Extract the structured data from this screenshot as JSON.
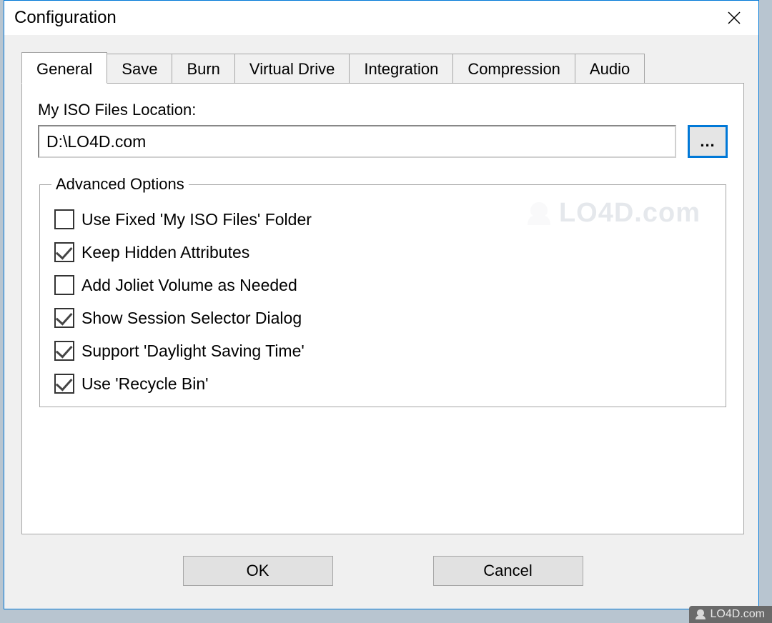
{
  "window": {
    "title": "Configuration"
  },
  "tabs": {
    "general": "General",
    "save": "Save",
    "burn": "Burn",
    "virtual_drive": "Virtual Drive",
    "integration": "Integration",
    "compression": "Compression",
    "audio": "Audio"
  },
  "general_panel": {
    "iso_location_label": "My ISO Files Location:",
    "iso_location_value": "D:\\LO4D.com",
    "browse_label": "...",
    "advanced_legend": "Advanced Options",
    "options": {
      "use_fixed_folder": {
        "label": "Use Fixed 'My ISO Files' Folder",
        "checked": false
      },
      "keep_hidden": {
        "label": "Keep Hidden Attributes",
        "checked": true
      },
      "add_joliet": {
        "label": "Add Joliet Volume as Needed",
        "checked": false
      },
      "show_session": {
        "label": "Show Session Selector Dialog",
        "checked": true
      },
      "support_dst": {
        "label": "Support 'Daylight Saving Time'",
        "checked": true
      },
      "use_recycle": {
        "label": "Use 'Recycle Bin'",
        "checked": true
      }
    }
  },
  "buttons": {
    "ok": "OK",
    "cancel": "Cancel"
  },
  "watermark": {
    "site": "LO4D.com",
    "center": "LO4D.com"
  }
}
